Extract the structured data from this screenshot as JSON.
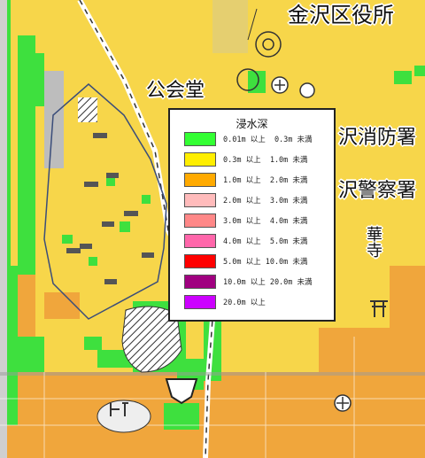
{
  "map": {
    "labels": [
      {
        "id": "ward-office",
        "text": "金沢区役所"
      },
      {
        "id": "hall",
        "text": "公会堂"
      },
      {
        "id": "fire",
        "text": "沢消防署"
      },
      {
        "id": "police",
        "text": "沢警察署"
      },
      {
        "id": "temple",
        "text": "華寺"
      }
    ],
    "colors": {
      "depth_0_3": "#f7d64a",
      "depth_0_01": "#3ee03e",
      "depth_1_2": "#f0a63c",
      "building_outline": "#3a4d7a",
      "rail_line": "#ffffff"
    },
    "icons": [
      "temple-symbol-icon",
      "post-office-icon",
      "shrine-icon",
      "ward-office-icon"
    ]
  },
  "legend": {
    "title": "浸水深",
    "items": [
      {
        "color": "#33ff33",
        "text": "0.01m 以上  0.3m 未満"
      },
      {
        "color": "#ffee00",
        "text": "0.3m 以上  1.0m 未満"
      },
      {
        "color": "#ffaa00",
        "text": "1.0m 以上  2.0m 未満"
      },
      {
        "color": "#ffbbbb",
        "text": "2.0m 以上  3.0m 未満"
      },
      {
        "color": "#ff8888",
        "text": "3.0m 以上  4.0m 未満"
      },
      {
        "color": "#ff66aa",
        "text": "4.0m 以上  5.0m 未満"
      },
      {
        "color": "#ff0000",
        "text": "5.0m 以上 10.0m 未満"
      },
      {
        "color": "#a00080",
        "text": "10.0m 以上 20.0m 未満"
      },
      {
        "color": "#cc00ff",
        "text": "20.0m 以上"
      }
    ]
  }
}
